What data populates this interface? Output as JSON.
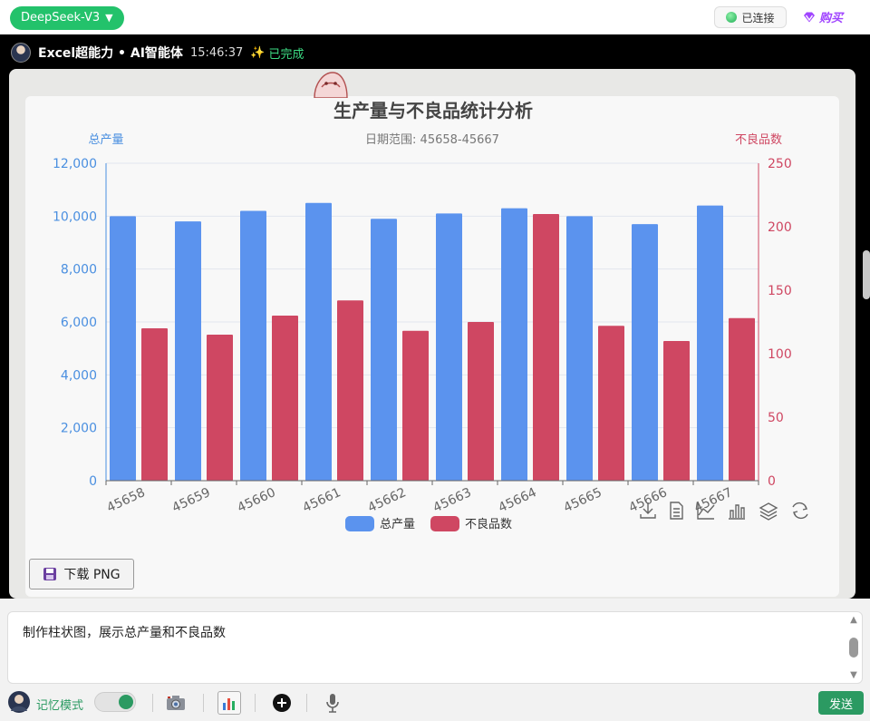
{
  "app": {
    "model_button": "DeepSeek-V3",
    "connection_status": "已连接",
    "buy_label": "购买"
  },
  "message": {
    "sender": "Excel超能力 • AI智能体",
    "time": "15:46:37",
    "status": "已完成"
  },
  "toolbox_icons": [
    "download-icon",
    "data-view-icon",
    "line-chart-icon",
    "bar-chart-icon",
    "stack-icon",
    "restore-icon"
  ],
  "chart_data": {
    "type": "bar",
    "title": "生产量与不良品统计分析",
    "subtitle": "日期范围: 45658-45667",
    "ylabel_left": "总产量",
    "ylabel_right": "不良品数",
    "categories": [
      "45658",
      "45659",
      "45660",
      "45661",
      "45662",
      "45663",
      "45664",
      "45665",
      "45666",
      "45667"
    ],
    "series": [
      {
        "name": "总产量",
        "axis": "left",
        "color": "#5b93ee",
        "values": [
          10000,
          9800,
          10200,
          10500,
          9900,
          10100,
          10300,
          10000,
          9700,
          10400
        ]
      },
      {
        "name": "不良品数",
        "axis": "right",
        "color": "#cf4762",
        "values": [
          120,
          115,
          130,
          142,
          118,
          125,
          210,
          122,
          110,
          128
        ]
      }
    ],
    "ylim_left": [
      0,
      12000
    ],
    "ylim_right": [
      0,
      250
    ],
    "yticks_left": [
      "0",
      "2,000",
      "4,000",
      "6,000",
      "8,000",
      "10,000",
      "12,000"
    ],
    "yticks_right": [
      "0",
      "50",
      "100",
      "150",
      "200",
      "250"
    ],
    "legend": "bottom-center",
    "grid": true
  },
  "download_button": "下载 PNG",
  "input": {
    "value": "制作柱状图，展示总产量和不良品数"
  },
  "bottom": {
    "memory_label": "记忆模式",
    "memory_on": true,
    "send_label": "发送"
  }
}
